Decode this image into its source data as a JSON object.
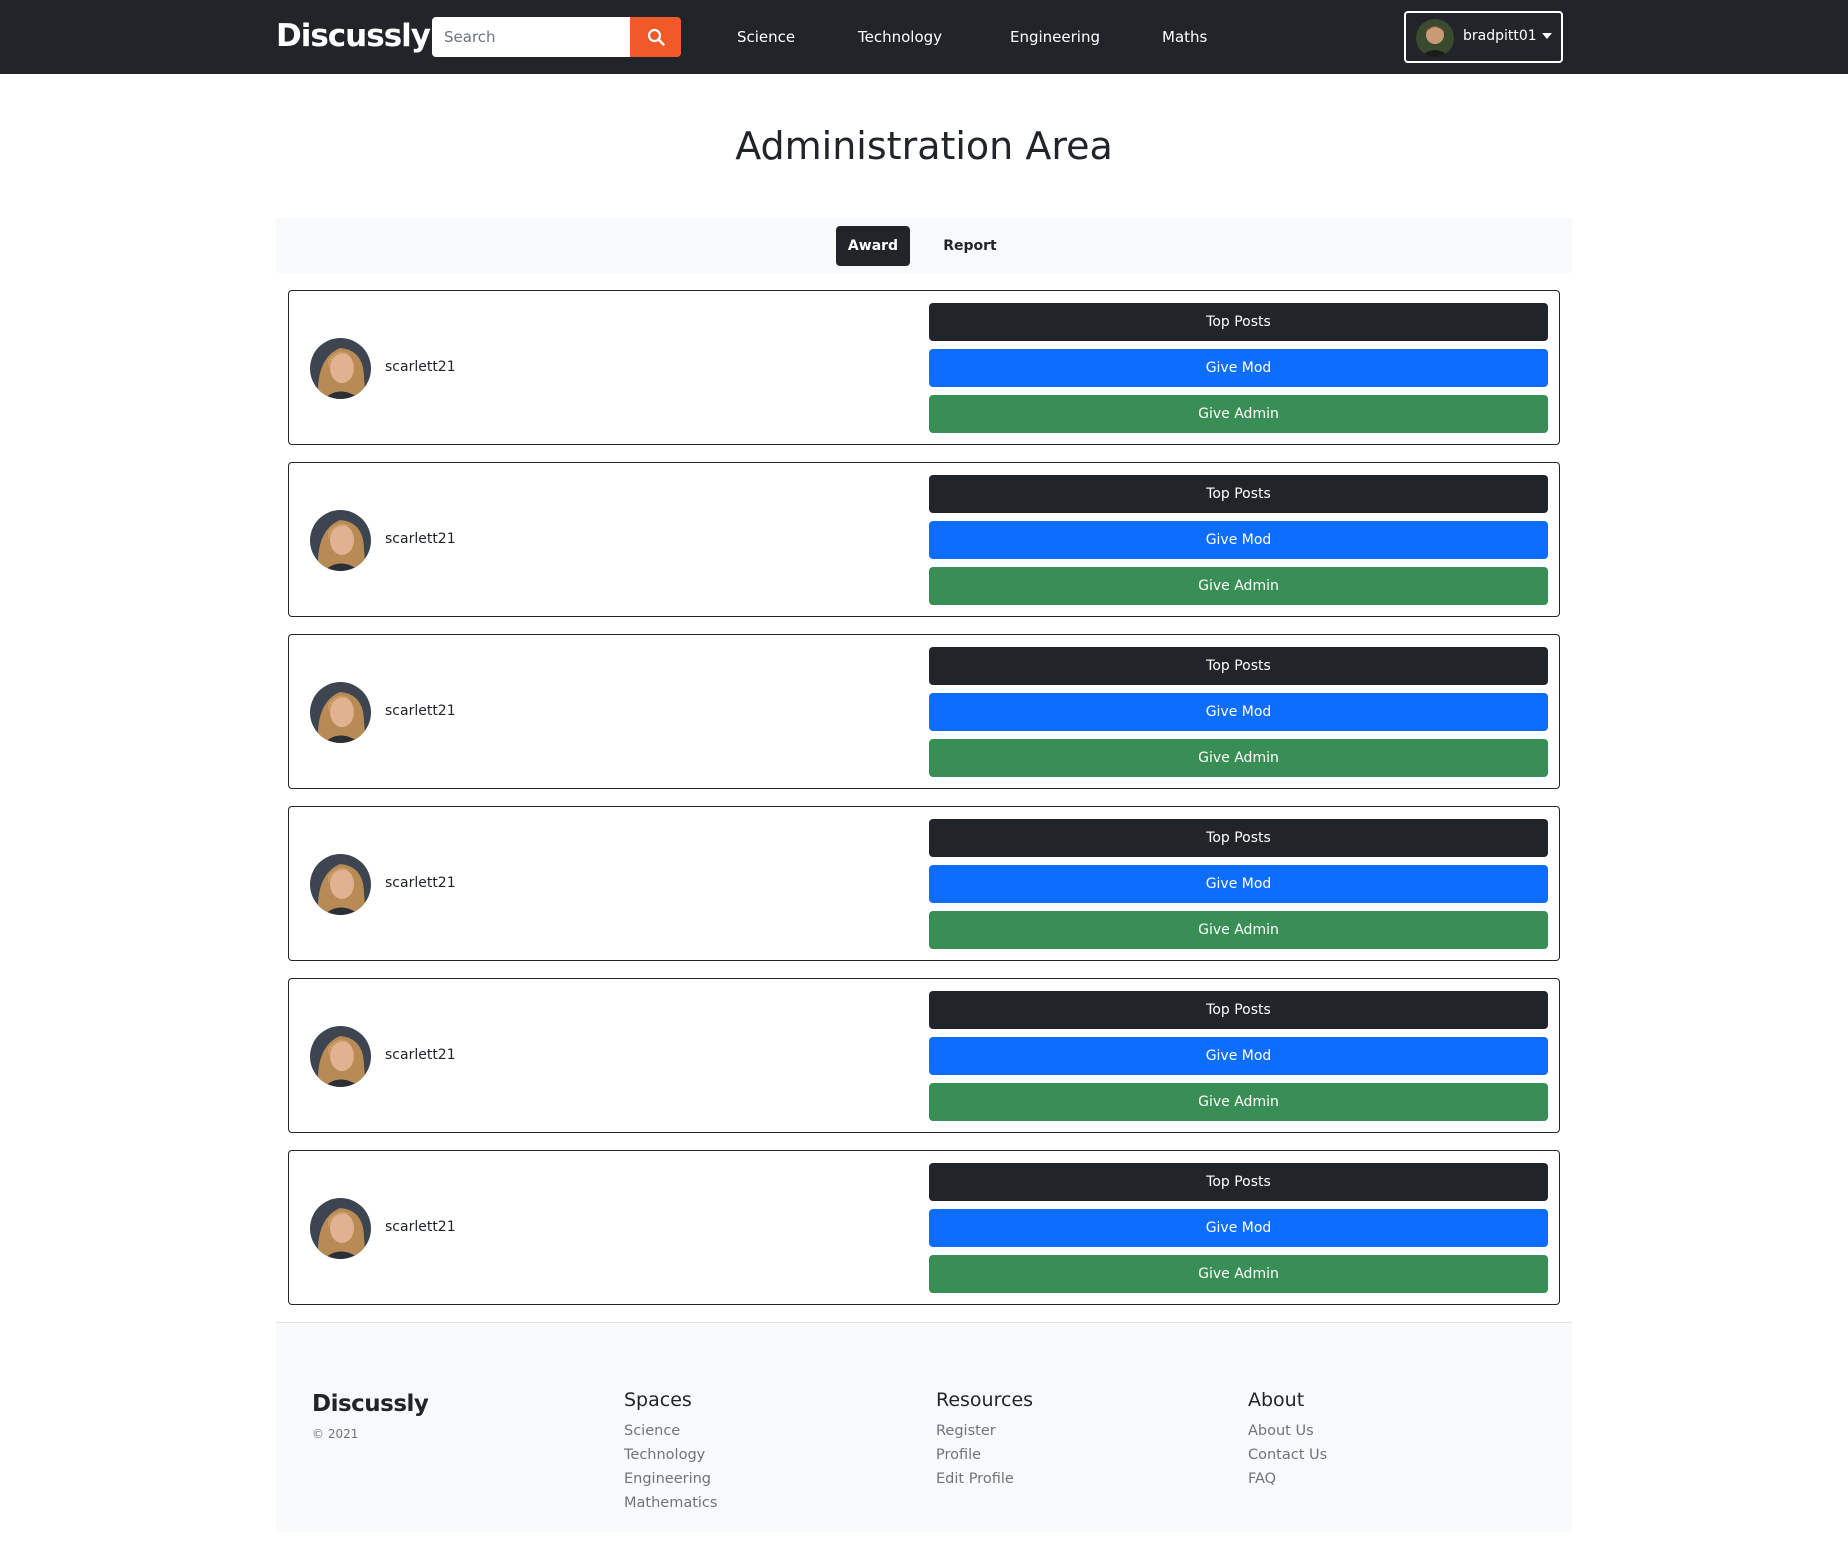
{
  "navbar": {
    "brand": "Discussly",
    "search_placeholder": "Search",
    "links": [
      "Science",
      "Technology",
      "Engineering",
      "Maths"
    ],
    "username": "bradpitt01"
  },
  "page_title": "Administration Area",
  "tabs": {
    "award": "Award",
    "report": "Report",
    "active": "Award"
  },
  "users": [
    {
      "username": "scarlett21",
      "buttons": {
        "top_posts": "Top Posts",
        "give_mod": "Give Mod",
        "give_admin": "Give Admin"
      }
    },
    {
      "username": "scarlett21",
      "buttons": {
        "top_posts": "Top Posts",
        "give_mod": "Give Mod",
        "give_admin": "Give Admin"
      }
    },
    {
      "username": "scarlett21",
      "buttons": {
        "top_posts": "Top Posts",
        "give_mod": "Give Mod",
        "give_admin": "Give Admin"
      }
    },
    {
      "username": "scarlett21",
      "buttons": {
        "top_posts": "Top Posts",
        "give_mod": "Give Mod",
        "give_admin": "Give Admin"
      }
    },
    {
      "username": "scarlett21",
      "buttons": {
        "top_posts": "Top Posts",
        "give_mod": "Give Mod",
        "give_admin": "Give Admin"
      }
    },
    {
      "username": "scarlett21",
      "buttons": {
        "top_posts": "Top Posts",
        "give_mod": "Give Mod",
        "give_admin": "Give Admin"
      }
    }
  ],
  "footer": {
    "brand": "Discussly",
    "copyright": "© 2021",
    "columns": [
      {
        "heading": "Spaces",
        "links": [
          "Science",
          "Technology",
          "Engineering",
          "Mathematics"
        ]
      },
      {
        "heading": "Resources",
        "links": [
          "Register",
          "Profile",
          "Edit Profile"
        ]
      },
      {
        "heading": "About",
        "links": [
          "About Us",
          "Contact Us",
          "FAQ"
        ]
      }
    ]
  },
  "colors": {
    "navbar_bg": "#212529",
    "search_button": "#f05a28",
    "mod_button": "#0d6efd",
    "admin_button": "#388e54",
    "dark_button": "#212529"
  },
  "icons": {
    "search": "search-icon",
    "dropdown": "caret-down-icon"
  }
}
